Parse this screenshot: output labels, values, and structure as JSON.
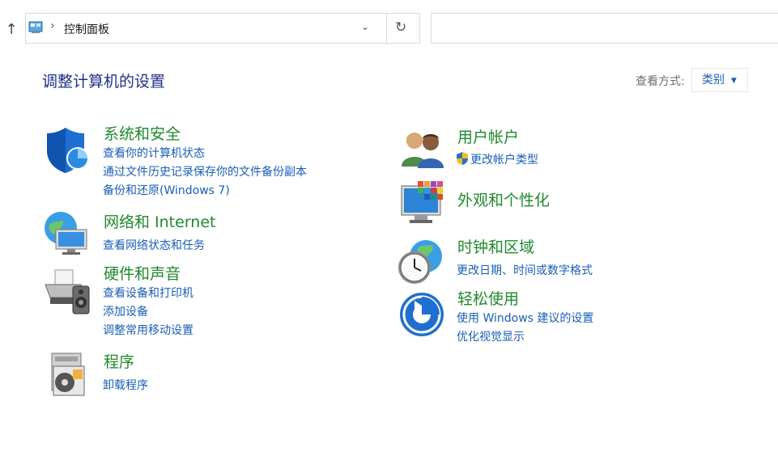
{
  "address_bar": {
    "location": "控制面板"
  },
  "page_title": "调整计算机的设置",
  "view_by": {
    "label": "查看方式:",
    "value": "类别"
  },
  "categories": {
    "system_security": {
      "title": "系统和安全",
      "links": [
        "查看你的计算机状态",
        "通过文件历史记录保存你的文件备份副本",
        "备份和还原(Windows 7)"
      ]
    },
    "network_internet": {
      "title": "网络和 Internet",
      "links": [
        "查看网络状态和任务"
      ]
    },
    "hardware_sound": {
      "title": "硬件和声音",
      "links": [
        "查看设备和打印机",
        "添加设备",
        "调整常用移动设置"
      ]
    },
    "programs": {
      "title": "程序",
      "links": [
        "卸载程序"
      ]
    },
    "user_accounts": {
      "title": "用户帐户",
      "links": [
        "更改帐户类型"
      ]
    },
    "appearance": {
      "title": "外观和个性化",
      "links": []
    },
    "clock_region": {
      "title": "时钟和区域",
      "links": [
        "更改日期、时间或数字格式"
      ]
    },
    "ease_of_access": {
      "title": "轻松使用",
      "links": [
        "使用 Windows 建议的设置",
        "优化视觉显示"
      ]
    }
  }
}
